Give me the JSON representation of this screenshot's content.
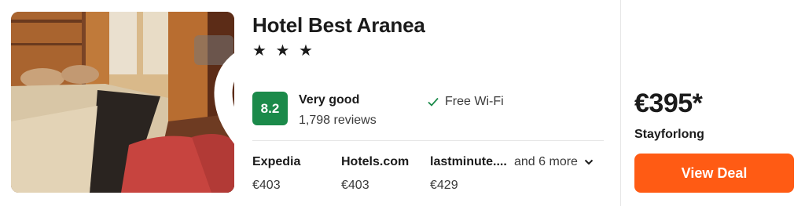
{
  "hotel": {
    "name": "Hotel Best Aranea",
    "stars": "★ ★ ★",
    "star_count": 3
  },
  "rating": {
    "score": "8.2",
    "label": "Very good",
    "reviews": "1,798 reviews"
  },
  "amenity": {
    "icon": "checkmark-icon",
    "label": "Free Wi-Fi"
  },
  "providers": [
    {
      "name": "Expedia",
      "price": "€403"
    },
    {
      "name": "Hotels.com",
      "price": "€403"
    },
    {
      "name": "lastminute....",
      "price": "€429"
    }
  ],
  "more_providers": "and 6 more",
  "deal": {
    "price": "€395*",
    "site": "Stayforlong",
    "button_label": "View Deal"
  },
  "colors": {
    "score_badge": "#1b8a4a",
    "deal_button": "#ff5b14",
    "check": "#1b8a4a"
  },
  "icons": {
    "favorite": "heart-icon",
    "expand": "chevron-down-icon"
  }
}
